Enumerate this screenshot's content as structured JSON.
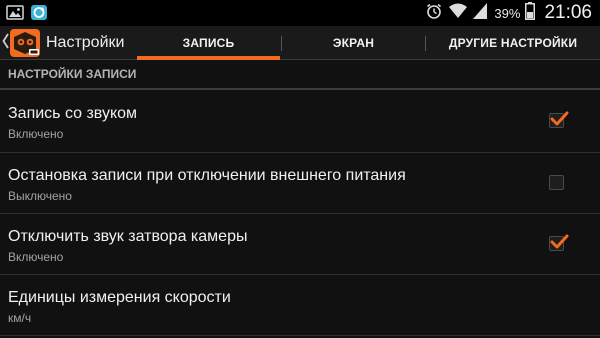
{
  "status_bar": {
    "left_icons": [
      "gallery-icon",
      "sync-app-icon"
    ],
    "right_icons": [
      "alarm-icon",
      "wifi-icon",
      "signal-icon",
      "battery-icon"
    ],
    "battery_percent": "39%",
    "time": "21:06"
  },
  "action_bar": {
    "title": "Настройки",
    "tabs": [
      {
        "label": "ЗАПИСЬ",
        "selected": true
      },
      {
        "label": "ЭКРАН",
        "selected": false
      },
      {
        "label": "ДРУГИЕ НАСТРОЙКИ",
        "selected": false
      }
    ]
  },
  "section": {
    "title": "НАСТРОЙКИ ЗАПИСИ"
  },
  "settings": [
    {
      "title": "Запись со звуком",
      "summary": "Включено",
      "checked": true
    },
    {
      "title": "Остановка записи при отключении внешнего питания",
      "summary": "Выключено",
      "checked": false
    },
    {
      "title": "Отключить звук затвора камеры",
      "summary": "Включено",
      "checked": true
    },
    {
      "title": "Единицы измерения скорости",
      "summary": "км/ч"
    }
  ],
  "colors": {
    "accent": "#f26b1f",
    "background": "#111111",
    "status_bar": "#000000"
  }
}
